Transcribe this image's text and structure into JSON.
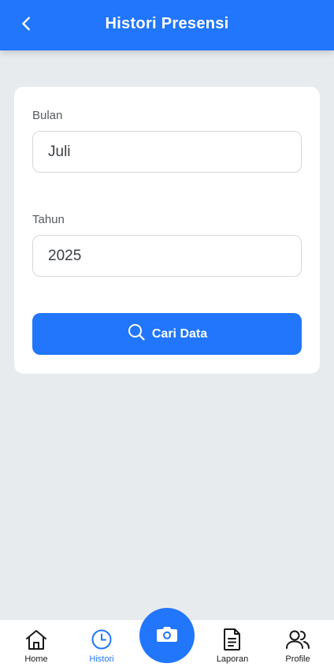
{
  "header": {
    "title": "Histori Presensi",
    "back_icon": "chevron-left-icon"
  },
  "form": {
    "month_label": "Bulan",
    "month_value": "Juli",
    "year_label": "Tahun",
    "year_value": "2025",
    "search_button_label": "Cari Data",
    "search_icon": "search-icon"
  },
  "bottom_nav": {
    "items": [
      {
        "label": "Home",
        "icon": "home-icon",
        "active": false
      },
      {
        "label": "Histori",
        "icon": "clock-icon",
        "active": true
      },
      {
        "label": "Laporan",
        "icon": "document-icon",
        "active": false
      },
      {
        "label": "Profile",
        "icon": "users-icon",
        "active": false
      }
    ],
    "fab_icon": "camera-icon"
  },
  "colors": {
    "primary": "#2176fb",
    "background": "#e8ebee",
    "card": "#ffffff"
  }
}
